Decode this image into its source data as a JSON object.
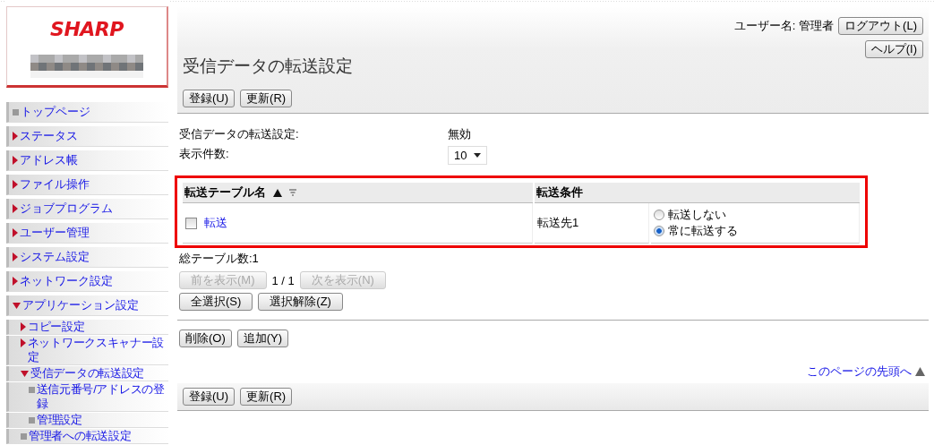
{
  "logo": {
    "brand": "SHARP"
  },
  "sidebar": {
    "items": [
      {
        "label": "トップページ",
        "kind": "page"
      },
      {
        "label": "ステータス",
        "kind": "folder",
        "expanded": false
      },
      {
        "label": "アドレス帳",
        "kind": "folder",
        "expanded": false
      },
      {
        "label": "ファイル操作",
        "kind": "folder",
        "expanded": false
      },
      {
        "label": "ジョブプログラム",
        "kind": "folder",
        "expanded": false
      },
      {
        "label": "ユーザー管理",
        "kind": "folder",
        "expanded": false
      },
      {
        "label": "システム設定",
        "kind": "folder",
        "expanded": false
      },
      {
        "label": "ネットワーク設定",
        "kind": "folder",
        "expanded": false
      },
      {
        "label": "アプリケーション設定",
        "kind": "folder",
        "expanded": true,
        "children": [
          {
            "label": "コピー設定",
            "kind": "folder",
            "expanded": false
          },
          {
            "label": "ネットワークスキャナー設定",
            "kind": "folder",
            "expanded": false
          },
          {
            "label": "受信データの転送設定",
            "kind": "folder",
            "expanded": true,
            "children": [
              {
                "label": "送信元番号/アドレスの登録",
                "kind": "page"
              },
              {
                "label": "管理設定",
                "kind": "page"
              }
            ]
          },
          {
            "label": "管理者への転送設定",
            "kind": "page"
          }
        ]
      }
    ]
  },
  "header": {
    "user_label": "ユーザー名:",
    "user_name": "管理者",
    "logout": "ログアウト(L)",
    "help": "ヘルプ(I)",
    "title": "受信データの転送設定",
    "buttons": [
      "登録(U)",
      "更新(R)"
    ]
  },
  "settings": [
    {
      "label": "受信データの転送設定:",
      "value": "無効",
      "kind": "text"
    },
    {
      "label": "表示件数:",
      "value": "10",
      "kind": "select"
    }
  ],
  "table": {
    "columns": [
      {
        "label": "転送テーブル名",
        "sortable": true
      },
      {
        "label": "転送条件",
        "sortable": false
      }
    ],
    "rows": [
      {
        "name": "転送",
        "checked": false,
        "destination": "転送先1",
        "options": [
          {
            "label": "転送しない",
            "selected": false
          },
          {
            "label": "常に転送する",
            "selected": true
          }
        ]
      }
    ]
  },
  "total": "総テーブル数:1",
  "pager": {
    "prev": {
      "label": "前を表示(M)",
      "disabled": true
    },
    "page": "1 / 1",
    "next": {
      "label": "次を表示(N)",
      "disabled": true
    }
  },
  "selection_buttons": [
    "全選択(S)",
    "選択解除(Z)"
  ],
  "action_buttons": [
    "削除(O)",
    "追加(Y)"
  ],
  "top_link": "このページの先頭へ",
  "footer_buttons": [
    "登録(U)",
    "更新(R)"
  ]
}
